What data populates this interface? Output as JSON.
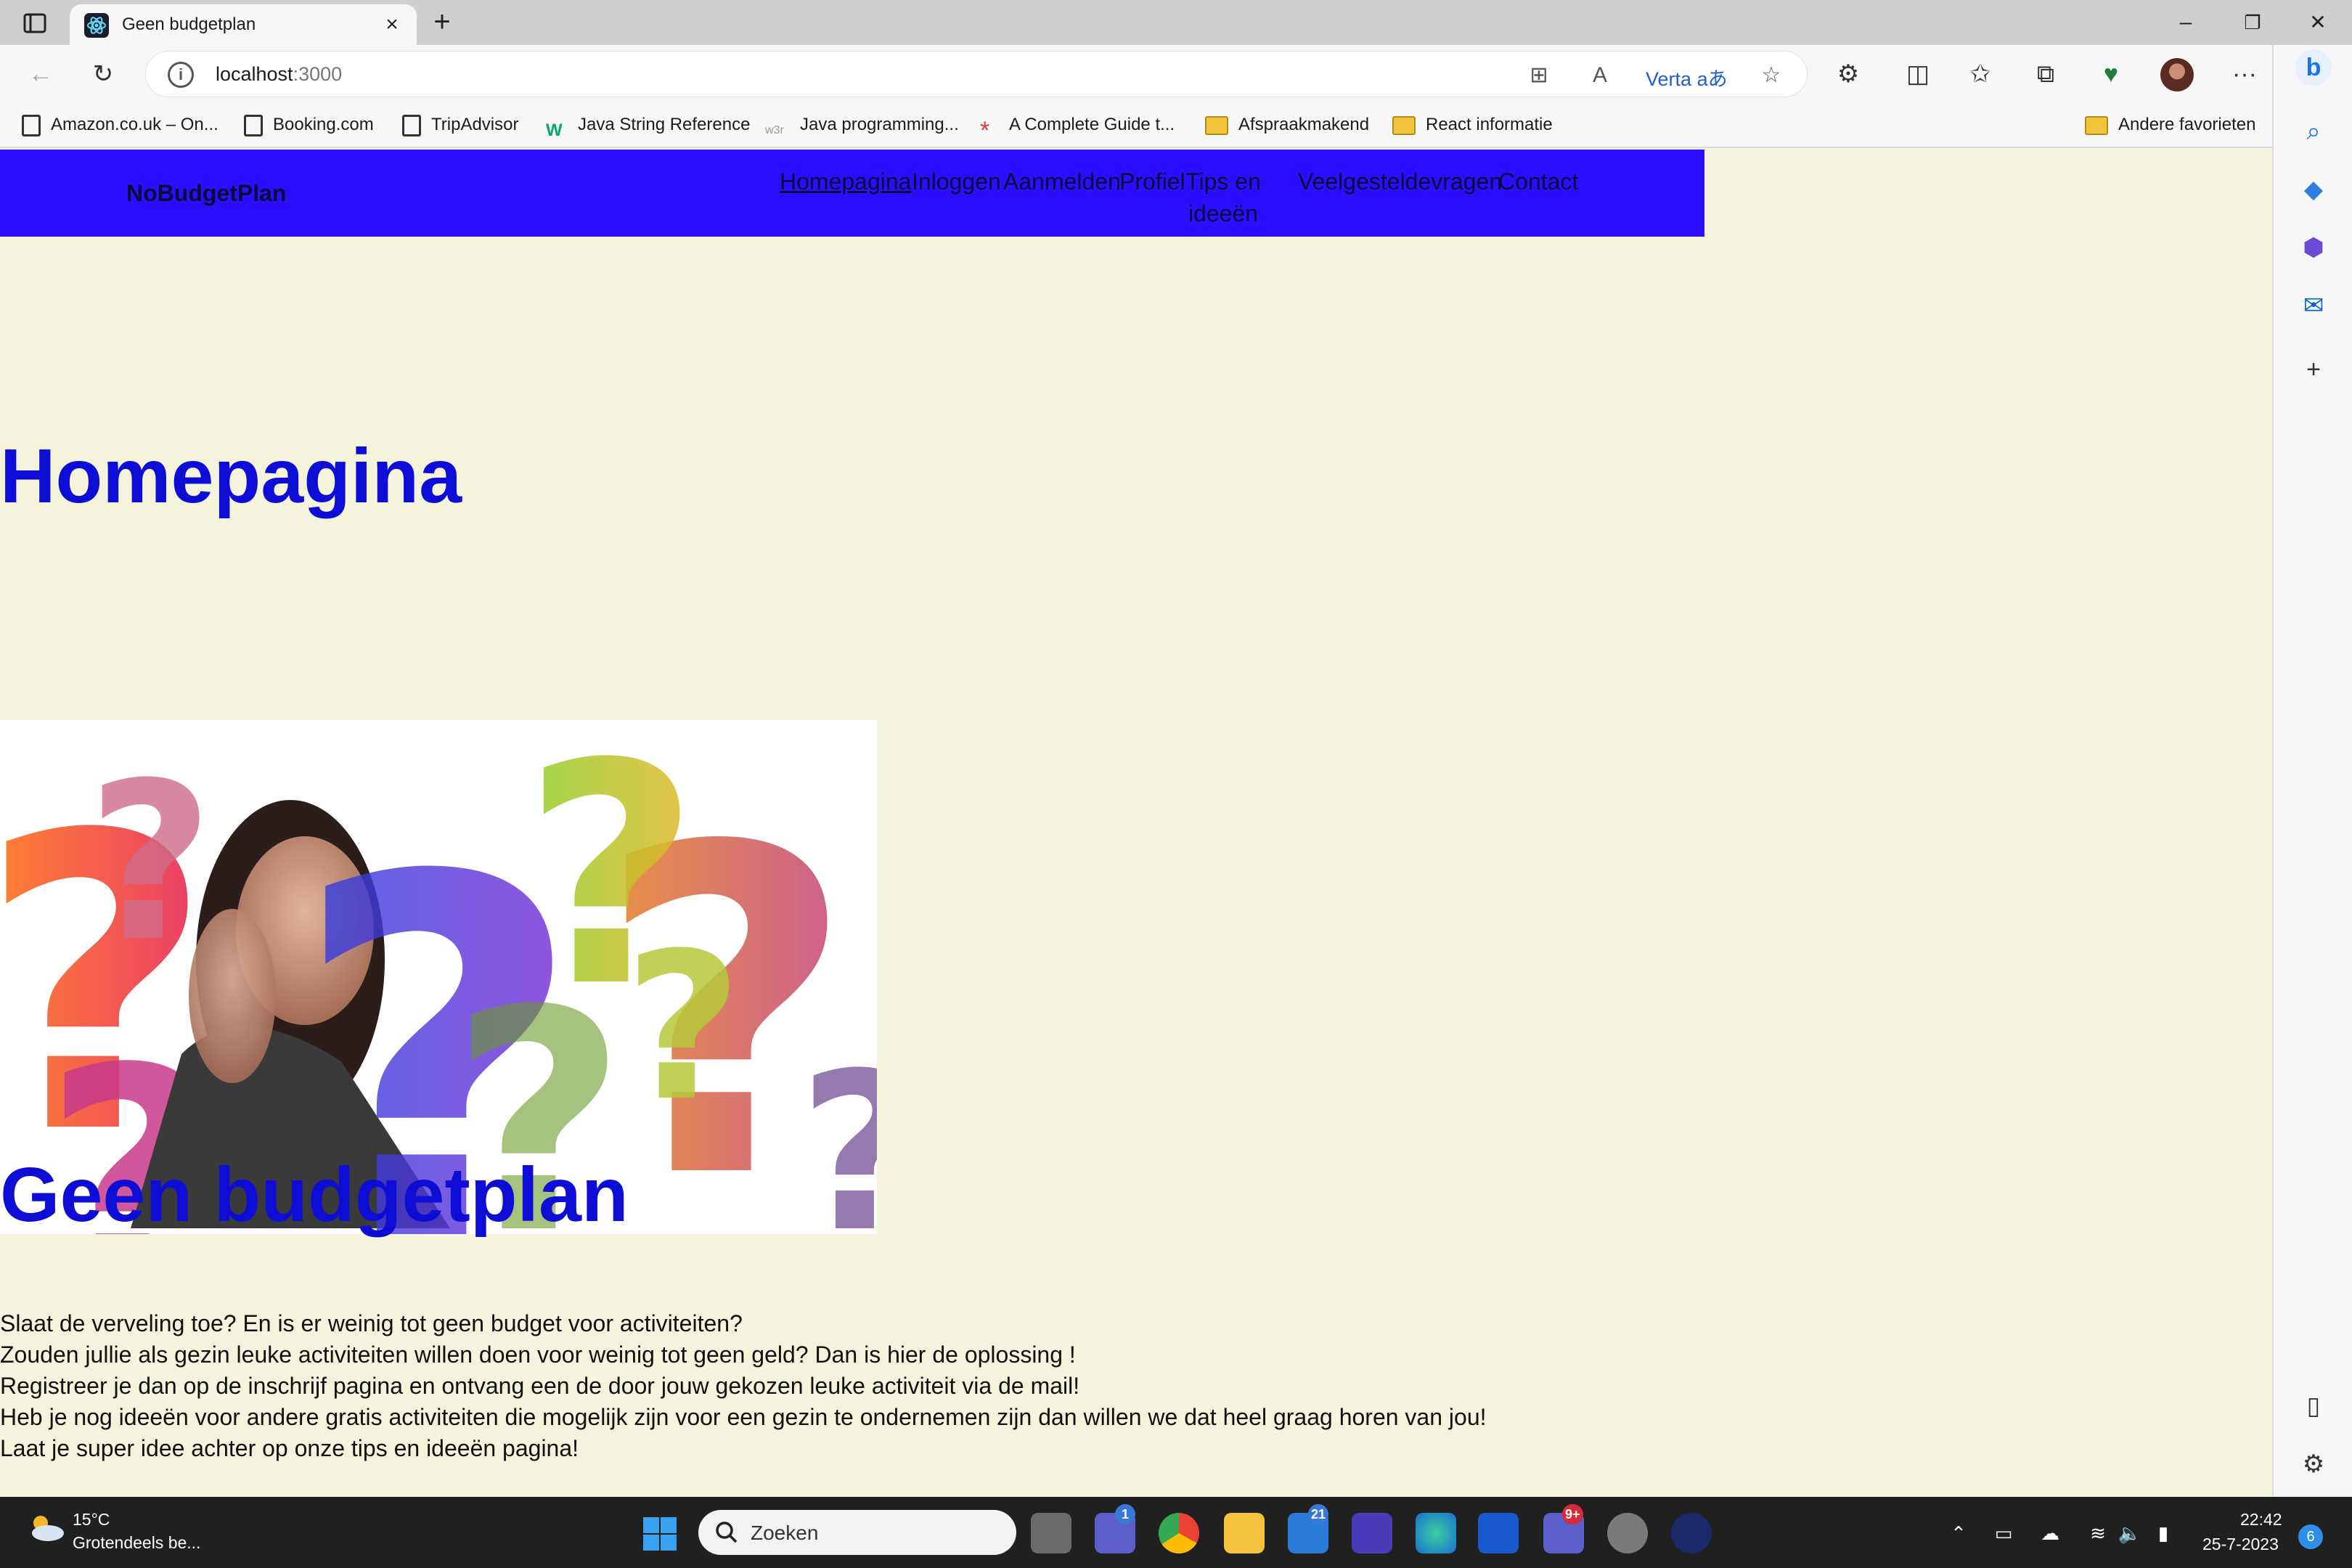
{
  "browser": {
    "tab_title": "Geen budgetplan",
    "new_tab_symbol": "+",
    "close_tab_symbol": "×",
    "url_host": "localhost",
    "url_port": ":3000",
    "translate_label": "Verta",
    "translate_glyph": "aあ",
    "more_symbol": "···",
    "window_controls": {
      "minimize": "–",
      "restore": "❐",
      "close": "✕"
    }
  },
  "bookmarks": [
    {
      "label": "Amazon.co.uk – On...",
      "icon": "page-icon"
    },
    {
      "label": "Booking.com",
      "icon": "page-icon"
    },
    {
      "label": "TripAdvisor",
      "icon": "page-icon"
    },
    {
      "label": "Java String Reference",
      "icon": "w3-icon"
    },
    {
      "label": "Java programming...",
      "icon": "w3r-icon"
    },
    {
      "label": "A Complete Guide t...",
      "icon": "asterisk-icon"
    },
    {
      "label": "Afspraakmakend",
      "icon": "folder-icon"
    },
    {
      "label": "React informatie",
      "icon": "folder-icon"
    }
  ],
  "bookmarks_other": "Andere favorieten",
  "site": {
    "brand": "NoBudgetPlan",
    "nav": [
      {
        "label": "Homepagina",
        "active": true
      },
      {
        "label": "Inloggen"
      },
      {
        "label": "Aanmelden"
      },
      {
        "label": "Profiel"
      },
      {
        "label": "Tips en ideeën"
      },
      {
        "label": "Veelgesteldevragen"
      },
      {
        "label": "Contact"
      }
    ],
    "heading_home": "Homepagina",
    "hero_image": "question-marks-girl-image",
    "heading_main": "Geen budgetplan",
    "intro": [
      "Slaat de verveling toe? En is er weinig tot geen budget voor activiteiten?",
      "Zouden jullie als gezin leuke activiteiten willen doen voor weinig tot geen geld? Dan is hier de oplossing !",
      "Registreer je dan op de inschrijf pagina en ontvang een de door jouw gekozen leuke activiteit via de mail!",
      "Heb je nog ideeën voor andere gratis activiteiten die mogelijk zijn voor een gezin te ondernemen zijn dan willen we dat heel graag horen van jou!",
      "Laat je super idee achter op onze tips en ideeën pagina!"
    ],
    "colors": {
      "nav_bg": "#2b0dff",
      "page_bg": "#f4f4dc",
      "heading": "#0d0dd6"
    }
  },
  "taskbar": {
    "weather_temp": "15°C",
    "weather_desc": "Grotendeels be...",
    "search_placeholder": "Zoeken",
    "badges": {
      "teams_chat": "1",
      "mail": "21",
      "teams": "9+"
    },
    "time": "22:42",
    "date": "25-7-2023",
    "notifications": "6"
  }
}
